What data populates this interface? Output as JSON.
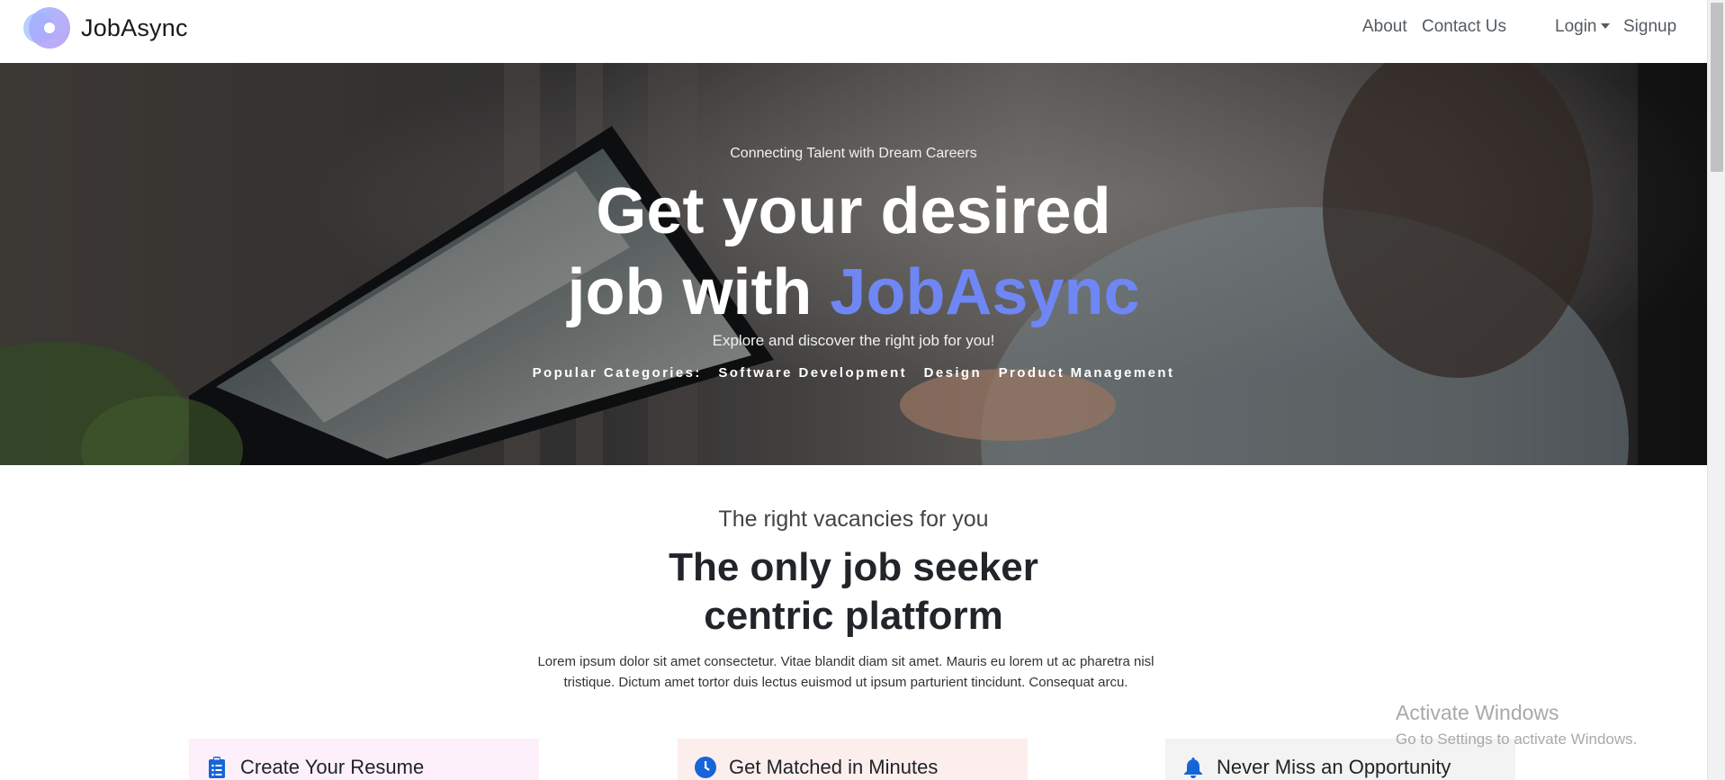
{
  "navbar": {
    "brand": "JobAsync",
    "about": "About",
    "contact": "Contact Us",
    "login": "Login",
    "signup": "Signup"
  },
  "hero": {
    "kicker": "Connecting Talent with Dream Careers",
    "title_line1": "Get your desired",
    "title_line2_prefix": "job with",
    "title_line2_accent": "JobAsync",
    "subtitle": "Explore and discover the right job for you!",
    "categories_label": "Popular Categories:",
    "categories": [
      "Software Development",
      "Design",
      "Product Management"
    ]
  },
  "section": {
    "kicker": "The right vacancies for you",
    "title_line1": "The only job seeker",
    "title_line2": "centric platform",
    "body": "Lorem ipsum dolor sit amet consectetur. Vitae blandit diam sit amet. Mauris eu lorem ut ac pharetra nisl tristique. Dictum amet tortor duis lectus euismod ut ipsum parturient tincidunt. Consequat arcu."
  },
  "cards": [
    {
      "label": "Create Your Resume",
      "icon": "clipboard-list-icon",
      "bg": "#fdf0fa"
    },
    {
      "label": "Get Matched in Minutes",
      "icon": "clock-icon",
      "bg": "#fdeeee"
    },
    {
      "label": "Never Miss an Opportunity",
      "icon": "bell-icon",
      "bg": "#f3f3f3"
    }
  ],
  "watermark": {
    "title": "Activate Windows",
    "subtitle": "Go to Settings to activate Windows."
  },
  "colors": {
    "accent": "#6f86f5",
    "icon_blue": "#1565d8"
  }
}
